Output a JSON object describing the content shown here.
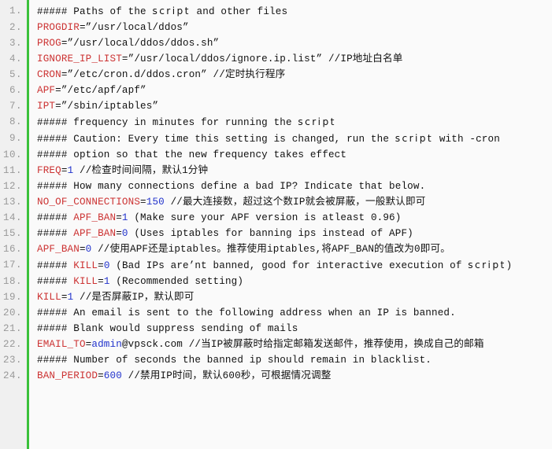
{
  "code_block": {
    "language": "shell",
    "gutter_color": "#f0f0f0",
    "rule_color": "#3ac13a",
    "background_color": "#fafafa",
    "token_colors": {
      "variable": "#cc3333",
      "number": "#2233cc",
      "plain": "#111111",
      "lineno": "#999999"
    },
    "lines": [
      {
        "number": "1.",
        "tokens": [
          {
            "t": "##### Paths of the ",
            "c": "plain"
          },
          {
            "t": "script",
            "c": "alt"
          },
          {
            "t": " and other files",
            "c": "plain"
          }
        ]
      },
      {
        "number": "2.",
        "tokens": [
          {
            "t": "PROGDIR",
            "c": "var"
          },
          {
            "t": "=”/usr/local/ddos”",
            "c": "plain"
          }
        ]
      },
      {
        "number": "3.",
        "tokens": [
          {
            "t": "PROG",
            "c": "var"
          },
          {
            "t": "=”/usr/local/ddos/ddos.sh”",
            "c": "plain"
          }
        ]
      },
      {
        "number": "4.",
        "tokens": [
          {
            "t": "IGNORE_IP_LIST",
            "c": "var"
          },
          {
            "t": "=”/usr/local/ddos/ignore.ip.list” //IP地址白名单",
            "c": "plain"
          }
        ]
      },
      {
        "number": "5.",
        "tokens": [
          {
            "t": "CRON",
            "c": "var"
          },
          {
            "t": "=”/etc/cron.d/ddos.cron” //定时执行程序",
            "c": "plain"
          }
        ]
      },
      {
        "number": "6.",
        "tokens": [
          {
            "t": "APF",
            "c": "var"
          },
          {
            "t": "=”/etc/apf/apf”",
            "c": "plain"
          }
        ]
      },
      {
        "number": "7.",
        "tokens": [
          {
            "t": "IPT",
            "c": "var"
          },
          {
            "t": "=”/sbin/iptables”",
            "c": "plain"
          }
        ]
      },
      {
        "number": "8.",
        "tokens": [
          {
            "t": "##### frequency in minutes for running the ",
            "c": "plain"
          },
          {
            "t": "script",
            "c": "alt"
          }
        ]
      },
      {
        "number": "9.",
        "tokens": [
          {
            "t": "##### Caution: Every time this setting is changed, run the ",
            "c": "plain"
          },
          {
            "t": "script",
            "c": "alt"
          },
          {
            "t": " with -cron",
            "c": "plain"
          }
        ]
      },
      {
        "number": "10.",
        "tokens": [
          {
            "t": "##### option so that the new frequency takes effect",
            "c": "plain"
          }
        ]
      },
      {
        "number": "11.",
        "tokens": [
          {
            "t": "FREQ",
            "c": "var"
          },
          {
            "t": "=",
            "c": "plain"
          },
          {
            "t": "1",
            "c": "num"
          },
          {
            "t": " //检查时间间隔，默认1分钟",
            "c": "plain"
          }
        ]
      },
      {
        "number": "12.",
        "tokens": [
          {
            "t": "##### How many connections define a bad IP? Indicate that below.",
            "c": "plain"
          }
        ]
      },
      {
        "number": "13.",
        "tokens": [
          {
            "t": "NO_OF_CONNECTIONS",
            "c": "var"
          },
          {
            "t": "=",
            "c": "plain"
          },
          {
            "t": "150",
            "c": "num"
          },
          {
            "t": " //最大连接数，超过这个数IP就会被屏蔽，一般默认即可",
            "c": "plain"
          }
        ]
      },
      {
        "number": "14.",
        "tokens": [
          {
            "t": "##### ",
            "c": "plain"
          },
          {
            "t": "APF_BAN",
            "c": "var"
          },
          {
            "t": "=",
            "c": "plain"
          },
          {
            "t": "1",
            "c": "num"
          },
          {
            "t": " (Make sure your APF version is atleast 0.96)",
            "c": "plain"
          }
        ]
      },
      {
        "number": "15.",
        "tokens": [
          {
            "t": "##### ",
            "c": "plain"
          },
          {
            "t": "APF_BAN",
            "c": "var"
          },
          {
            "t": "=",
            "c": "plain"
          },
          {
            "t": "0",
            "c": "num"
          },
          {
            "t": " (Uses iptables for banning ips instead of APF)",
            "c": "plain"
          }
        ]
      },
      {
        "number": "16.",
        "tokens": [
          {
            "t": "APF_BAN",
            "c": "var"
          },
          {
            "t": "=",
            "c": "plain"
          },
          {
            "t": "0",
            "c": "num"
          },
          {
            "t": " //使用APF还是iptables。推荐使用iptables,将APF_BAN的值改为0即可。",
            "c": "plain"
          }
        ]
      },
      {
        "number": "17.",
        "tokens": [
          {
            "t": "##### ",
            "c": "plain"
          },
          {
            "t": "KILL",
            "c": "var"
          },
          {
            "t": "=",
            "c": "plain"
          },
          {
            "t": "0",
            "c": "num"
          },
          {
            "t": " (Bad IPs are’nt banned, good for interactive execution of ",
            "c": "plain"
          },
          {
            "t": "script",
            "c": "alt"
          },
          {
            "t": ")",
            "c": "plain"
          }
        ]
      },
      {
        "number": "18.",
        "tokens": [
          {
            "t": "##### ",
            "c": "plain"
          },
          {
            "t": "KILL",
            "c": "var"
          },
          {
            "t": "=",
            "c": "plain"
          },
          {
            "t": "1",
            "c": "num"
          },
          {
            "t": " (Recommended setting)",
            "c": "plain"
          }
        ]
      },
      {
        "number": "19.",
        "tokens": [
          {
            "t": "KILL",
            "c": "var"
          },
          {
            "t": "=",
            "c": "plain"
          },
          {
            "t": "1",
            "c": "num"
          },
          {
            "t": " //是否屏蔽IP，默认即可",
            "c": "plain"
          }
        ]
      },
      {
        "number": "20.",
        "tokens": [
          {
            "t": "##### An email is sent to the following address when an IP is banned.",
            "c": "plain"
          }
        ]
      },
      {
        "number": "21.",
        "tokens": [
          {
            "t": "##### Blank would suppress sending of mails",
            "c": "plain"
          }
        ]
      },
      {
        "number": "22.",
        "tokens": [
          {
            "t": "EMAIL_TO",
            "c": "var"
          },
          {
            "t": "=",
            "c": "plain"
          },
          {
            "t": "admin",
            "c": "num"
          },
          {
            "t": "@vpsck.com //当IP被屏蔽时给指定邮箱发送邮件，推荐使用，换成自己的邮箱",
            "c": "plain"
          }
        ]
      },
      {
        "number": "23.",
        "tokens": [
          {
            "t": "##### Number of seconds the banned ip should remain in blacklist.",
            "c": "plain"
          }
        ]
      },
      {
        "number": "24.",
        "tokens": [
          {
            "t": "BAN_PERIOD",
            "c": "var"
          },
          {
            "t": "=",
            "c": "plain"
          },
          {
            "t": "600",
            "c": "num"
          },
          {
            "t": " //禁用IP时间，默认600秒，可根据情况调整",
            "c": "plain"
          }
        ]
      }
    ]
  }
}
